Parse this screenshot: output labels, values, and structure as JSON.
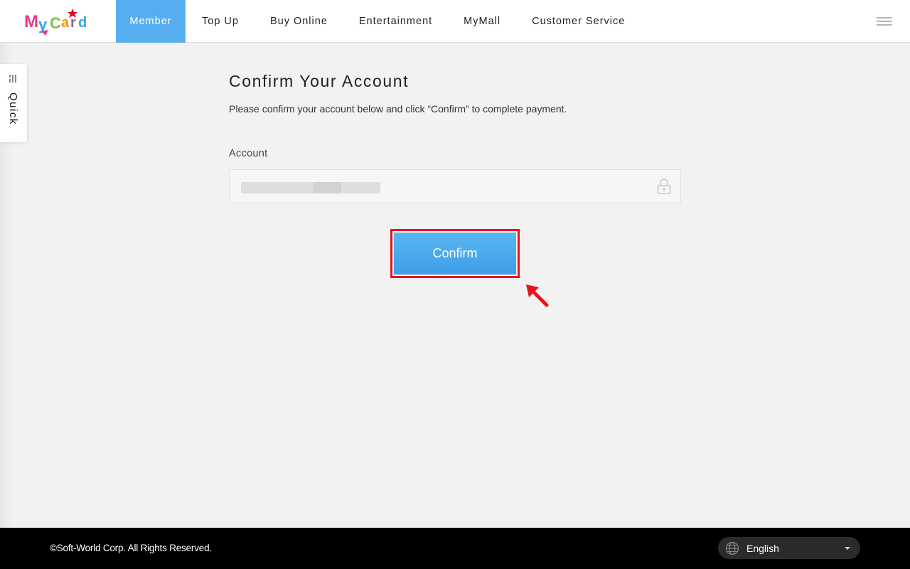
{
  "header": {
    "logo_text": "MyCard",
    "nav": [
      {
        "label": "Member",
        "active": true
      },
      {
        "label": "Top Up",
        "active": false
      },
      {
        "label": "Buy Online",
        "active": false
      },
      {
        "label": "Entertainment",
        "active": false
      },
      {
        "label": "MyMall",
        "active": false
      },
      {
        "label": "Customer Service",
        "active": false
      }
    ],
    "menu_icon": "hamburger-icon"
  },
  "quick_tab": {
    "label": "Quick",
    "icon": "list-icon"
  },
  "main": {
    "title": "Confirm Your Account",
    "description": "Please confirm your account below and click “Confirm” to complete payment.",
    "account_label": "Account",
    "account_value": "",
    "account_icon": "lock-icon",
    "confirm_label": "Confirm"
  },
  "footer": {
    "copyright": "©Soft-World Corp. All Rights Reserved.",
    "language": "English",
    "language_icon": "globe-icon"
  },
  "colors": {
    "accent": "#56aef0",
    "button": "#4aa8ee",
    "highlight": "#e8141b",
    "footer_bg": "#000000"
  }
}
